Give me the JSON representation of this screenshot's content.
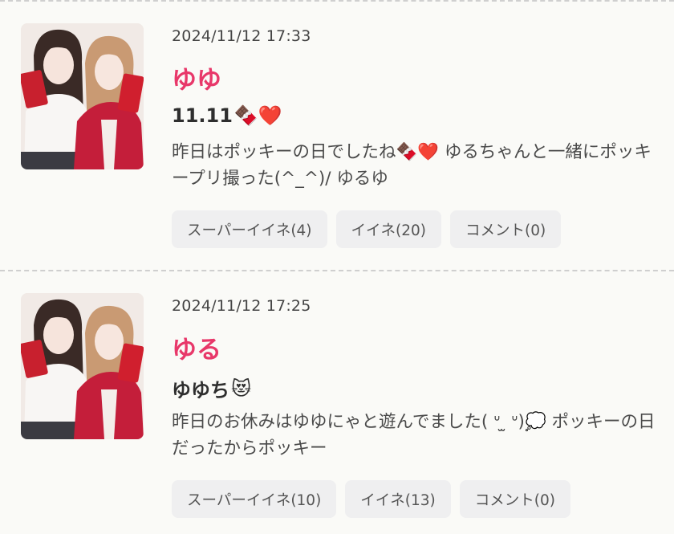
{
  "posts": [
    {
      "date": "2024/11/12 17:33",
      "author": "ゆゆ",
      "title_text": "11.11",
      "title_emoji": "🍫❤️",
      "body": " 昨日はポッキーの日でしたね🍫❤️ ゆるちゃんと一緒にポッキープリ撮った(^_^)/ ゆるゆ",
      "buttons": {
        "super_like": "スーパーイイネ(4)",
        "like": "イイネ(20)",
        "comment": "コメント(0)"
      }
    },
    {
      "date": "2024/11/12 17:25",
      "author": "ゆる",
      "title_text": "ゆゆち",
      "title_emoji": "😻",
      "body": "昨日のお休みはゆゆにゃと遊んでました( ᐡ ̫ ᐡ)💭 ポッキーの日だったからポッキー",
      "buttons": {
        "super_like": "スーパーイイネ(10)",
        "like": "イイネ(13)",
        "comment": "コメント(0)"
      }
    }
  ],
  "colors": {
    "author": "#e8386a",
    "button_bg": "#efeff0",
    "background": "#fafaf7"
  },
  "icons": {
    "photo": "purikura-photo-thumbnail"
  }
}
